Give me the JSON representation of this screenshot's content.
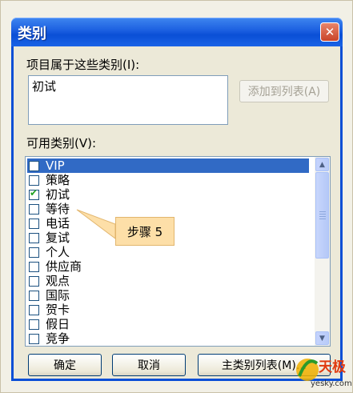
{
  "window": {
    "title": "类别",
    "close_glyph": "✕"
  },
  "assigned": {
    "label": "项目属于这些类别",
    "hotkey_label": "(I):",
    "hotkey": "I",
    "value": "初试"
  },
  "add_button": "添加到列表(A)",
  "available": {
    "label": "可用类别",
    "hotkey_label": "(V):",
    "hotkey": "V"
  },
  "categories": [
    {
      "label": "VIP",
      "checked": false,
      "selected": true
    },
    {
      "label": "策略",
      "checked": false,
      "selected": false
    },
    {
      "label": "初试",
      "checked": true,
      "selected": false
    },
    {
      "label": "等待",
      "checked": false,
      "selected": false
    },
    {
      "label": "电话",
      "checked": false,
      "selected": false
    },
    {
      "label": "复试",
      "checked": false,
      "selected": false
    },
    {
      "label": "个人",
      "checked": false,
      "selected": false
    },
    {
      "label": "供应商",
      "checked": false,
      "selected": false
    },
    {
      "label": "观点",
      "checked": false,
      "selected": false
    },
    {
      "label": "国际",
      "checked": false,
      "selected": false
    },
    {
      "label": "贺卡",
      "checked": false,
      "selected": false
    },
    {
      "label": "假日",
      "checked": false,
      "selected": false
    },
    {
      "label": "竞争",
      "checked": false,
      "selected": false
    }
  ],
  "buttons": {
    "ok": "确定",
    "cancel": "取消",
    "master": "主类别列表(M)..."
  },
  "annotation": "步骤 5",
  "watermark": {
    "brand": "天极",
    "site": "yesky.com"
  },
  "icons": {
    "close": "close-icon",
    "scroll_up": "scroll-up-arrow-icon",
    "scroll_down": "scroll-down-arrow-icon",
    "check": "checkmark-icon"
  },
  "colors": {
    "titlebar": "#0a4fd6",
    "selection": "#316ac5",
    "callout": "#fddfa8",
    "check": "#21a121"
  }
}
